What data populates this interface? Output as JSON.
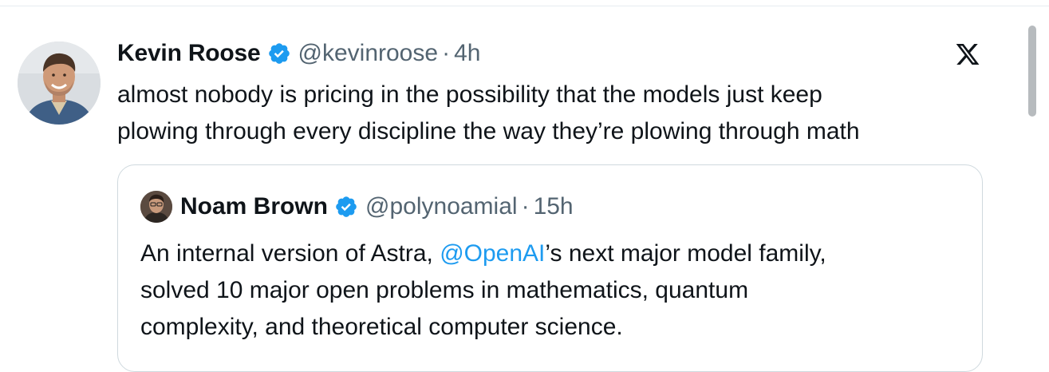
{
  "tweet": {
    "author_name": "Kevin Roose",
    "author_handle": "@kevinroose",
    "separator": "·",
    "time": "4h",
    "text_line1": "almost nobody is pricing in the possibility that the models just keep",
    "text_line2": "plowing through every discipline the way they’re plowing through math",
    "platform_icon": "x-logo-icon",
    "verified_icon": "verified-badge-icon"
  },
  "quoted_tweet": {
    "author_name": "Noam Brown",
    "author_handle": "@polynoamial",
    "separator": "·",
    "time": "15h",
    "text_part1": "An internal version of Astra, ",
    "mention": "@OpenAI",
    "text_part2": "’s next major model family,",
    "text_line2": "solved 10 major open problems in mathematics, quantum",
    "text_line3": "complexity, and theoretical computer science."
  },
  "colors": {
    "text_primary": "#0f1419",
    "text_secondary": "#536471",
    "verified_blue": "#1d9bf0",
    "mention_blue": "#1d9bf0",
    "border": "#cfd9de"
  }
}
